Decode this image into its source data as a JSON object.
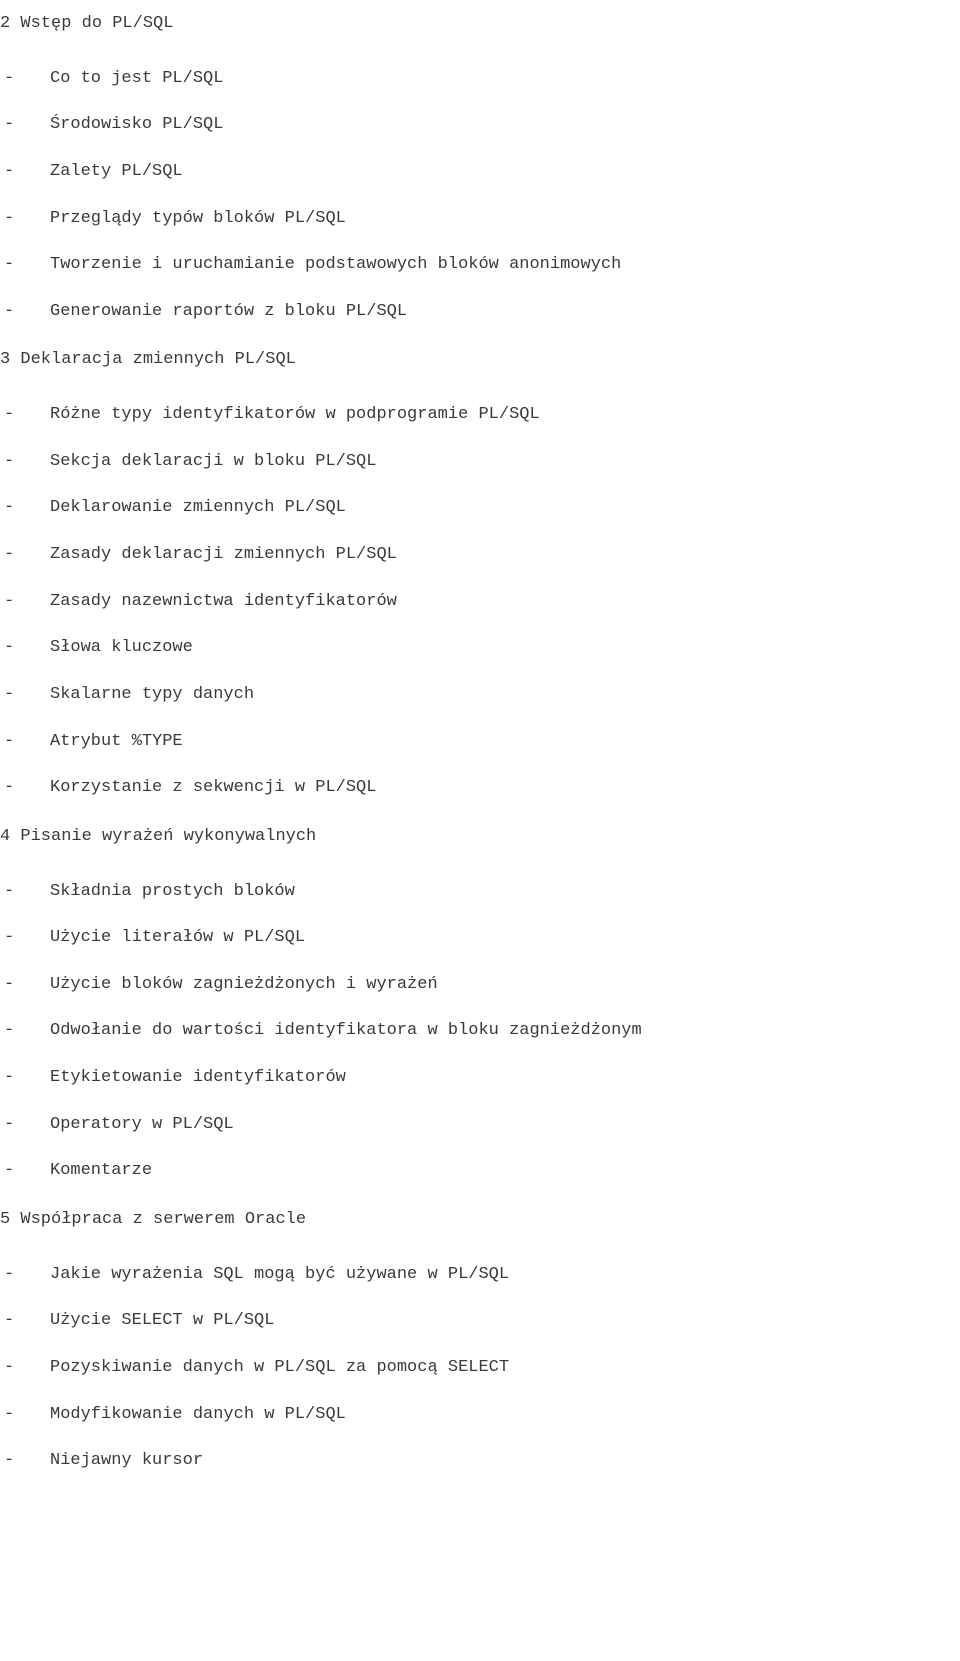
{
  "dash": "-",
  "sections": [
    {
      "heading": "2 Wstęp do PL/SQL",
      "items": [
        "Co to jest PL/SQL",
        "Środowisko PL/SQL",
        "Zalety PL/SQL",
        "Przeglądy typów bloków PL/SQL",
        "Tworzenie i uruchamianie podstawowych bloków anonimowych",
        "Generowanie raportów z bloku PL/SQL"
      ]
    },
    {
      "heading": "3 Deklaracja zmiennych PL/SQL",
      "items": [
        "Różne typy identyfikatorów w podprogramie PL/SQL",
        "Sekcja deklaracji w bloku PL/SQL",
        "Deklarowanie zmiennych PL/SQL",
        "Zasady deklaracji zmiennych PL/SQL",
        "Zasady nazewnictwa identyfikatorów",
        "Słowa kluczowe",
        "Skalarne typy danych",
        "Atrybut %TYPE",
        "Korzystanie z sekwencji w PL/SQL"
      ]
    },
    {
      "heading": "4 Pisanie wyrażeń wykonywalnych",
      "items": [
        "Składnia prostych bloków",
        "Użycie literałów w PL/SQL",
        "Użycie bloków zagnieżdżonych i wyrażeń",
        "Odwołanie do wartości identyfikatora w bloku zagnieżdżonym",
        "Etykietowanie identyfikatorów",
        "Operatory w PL/SQL",
        "Komentarze"
      ]
    },
    {
      "heading": "5 Współpraca z serwerem Oracle",
      "items": [
        "Jakie wyrażenia SQL mogą być używane w  PL/SQL",
        "Użycie SELECT w PL/SQL",
        "Pozyskiwanie danych w PL/SQL za pomocą SELECT",
        "Modyfikowanie danych w PL/SQL",
        "Niejawny kursor"
      ]
    }
  ]
}
